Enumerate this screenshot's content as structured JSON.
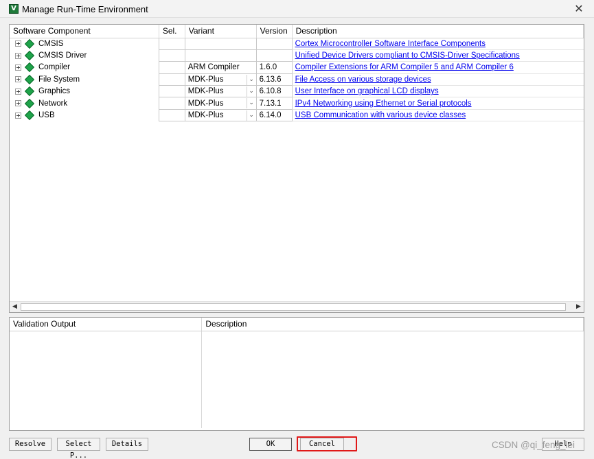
{
  "window": {
    "title": "Manage Run-Time Environment",
    "app_icon_glyph": "V",
    "close_glyph": "✕"
  },
  "components_table": {
    "columns": {
      "component": "Software Component",
      "sel": "Sel.",
      "variant": "Variant",
      "version": "Version",
      "description": "Description"
    },
    "rows": [
      {
        "name": "CMSIS",
        "variant": "",
        "has_dropdown": false,
        "version": "",
        "description": "Cortex Microcontroller Software Interface Components"
      },
      {
        "name": "CMSIS Driver",
        "variant": "",
        "has_dropdown": false,
        "version": "",
        "description": "Unified Device Drivers compliant to CMSIS-Driver Specifications"
      },
      {
        "name": "Compiler",
        "variant": "ARM Compiler",
        "has_dropdown": false,
        "version": "1.6.0",
        "description": "Compiler Extensions for ARM Compiler 5 and ARM Compiler 6"
      },
      {
        "name": "File System",
        "variant": "MDK-Plus",
        "has_dropdown": true,
        "version": "6.13.6",
        "description": "File Access on various storage devices"
      },
      {
        "name": "Graphics",
        "variant": "MDK-Plus",
        "has_dropdown": true,
        "version": "6.10.8",
        "description": "User Interface on graphical LCD displays"
      },
      {
        "name": "Network",
        "variant": "MDK-Plus",
        "has_dropdown": true,
        "version": "7.13.1",
        "description": "IPv4 Networking using Ethernet or Serial protocols"
      },
      {
        "name": "USB",
        "variant": "MDK-Plus",
        "has_dropdown": true,
        "version": "6.14.0",
        "description": "USB Communication with various device classes"
      }
    ]
  },
  "scrollbar": {
    "left_glyph": "◀",
    "right_glyph": "▶"
  },
  "validation_table": {
    "columns": {
      "output": "Validation Output",
      "description": "Description"
    }
  },
  "buttons": {
    "resolve": "Resolve",
    "select_packs": "Select P...",
    "details": "Details",
    "ok": "OK",
    "cancel": "Cancel",
    "help": "Help"
  },
  "watermark": "CSDN @qi_feng_lei",
  "icons": {
    "component": "green-diamond-icon",
    "expander": "plus-box-icon",
    "dropdown": "chevron-down-icon"
  },
  "colors": {
    "link": "#0000ee",
    "highlight": "#e01818",
    "component_icon": "#1ea34a"
  }
}
